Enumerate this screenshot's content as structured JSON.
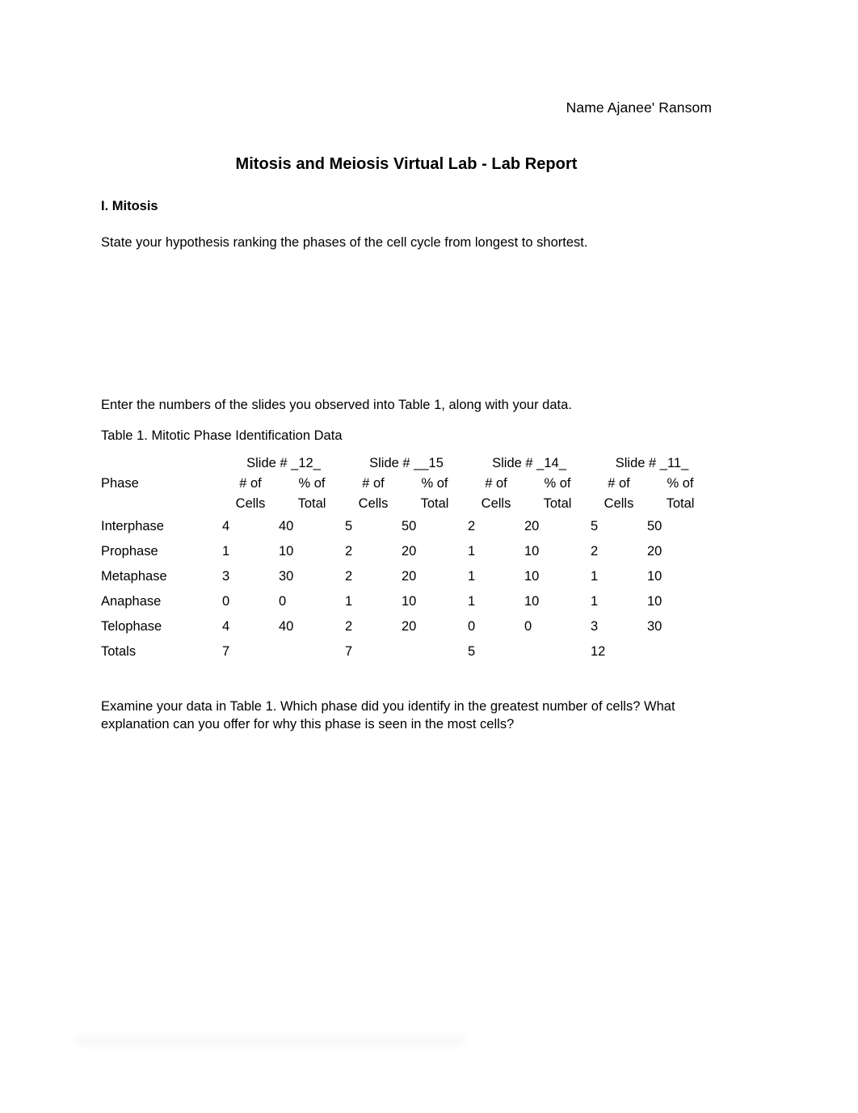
{
  "header": {
    "name_line": "Name Ajanee' Ransom"
  },
  "document": {
    "title": "Mitosis and Meiosis Virtual Lab - Lab Report",
    "section_heading": "I. Mitosis",
    "hypothesis_prompt": "State your hypothesis ranking the phases of the cell cycle from longest to shortest.",
    "hypothesis_answer": "",
    "table_intro": "Enter the numbers of the slides you observed into Table 1, along with your data.",
    "table_caption": "Table 1. Mitotic Phase Identification Data",
    "analysis_prompt": "Examine your data in Table 1. Which phase did you identify in the greatest number of cells? What explanation can you offer for why this phase is seen in the most cells?",
    "analysis_answer": ""
  },
  "table": {
    "phase_header": "Phase",
    "slide_headers": [
      "Slide # _12_",
      "Slide # __15",
      "Slide # _14_",
      "Slide # _11_"
    ],
    "sub_headers_line1": [
      "# of",
      "% of"
    ],
    "sub_headers_line2": [
      "Cells",
      "Total"
    ],
    "rows": [
      {
        "phase": "Interphase",
        "values": [
          "4",
          "40",
          "5",
          "50",
          "2",
          "20",
          "5",
          "50"
        ]
      },
      {
        "phase": "Prophase",
        "values": [
          "1",
          "10",
          "2",
          "20",
          "1",
          "10",
          "2",
          "20"
        ]
      },
      {
        "phase": "Metaphase",
        "values": [
          "3",
          "30",
          "2",
          "20",
          "1",
          "10",
          "1",
          "10"
        ]
      },
      {
        "phase": "Anaphase",
        "values": [
          "0",
          "0",
          "1",
          "10",
          "1",
          "10",
          "1",
          "10"
        ]
      },
      {
        "phase": "Telophase",
        "values": [
          "4",
          "40",
          "2",
          "20",
          "0",
          "0",
          "3",
          "30"
        ]
      },
      {
        "phase": "Totals",
        "values": [
          "7",
          "",
          "7",
          "",
          "5",
          "",
          "12",
          ""
        ]
      }
    ]
  }
}
